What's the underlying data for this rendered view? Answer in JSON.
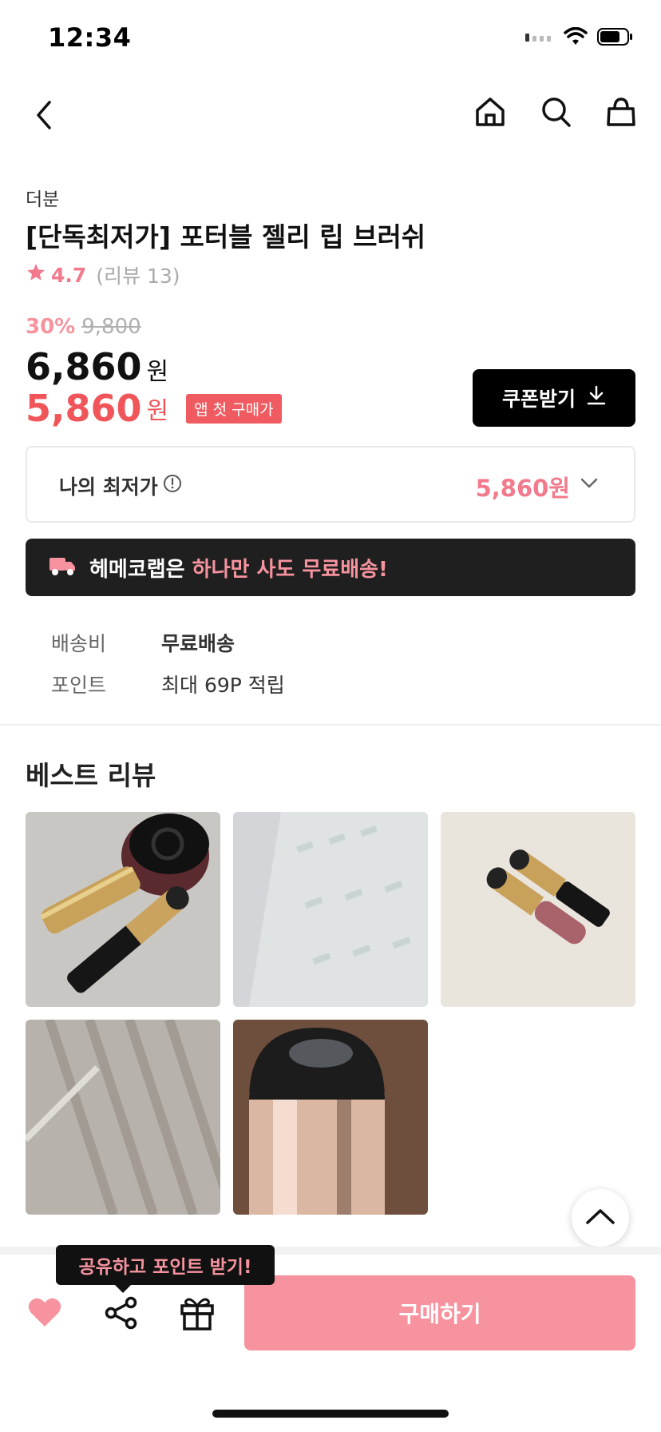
{
  "status_bar": {
    "time": "12:34"
  },
  "nav": {
    "back_icon": "chevron-left-icon",
    "home_icon": "home-icon",
    "search_icon": "search-icon",
    "cart_icon": "shopping-bag-icon"
  },
  "product": {
    "brand": "더분",
    "title": "[단독최저가] 포터블 젤리 립 브러쉬",
    "rating": "4.7",
    "review_count": "(리뷰 13)",
    "discount_percent": "30%",
    "original_price": "9,800",
    "price": "6,860",
    "price_unit": "원",
    "sale_price": "5,860",
    "sale_unit": "원",
    "app_badge": "앱 첫 구매가"
  },
  "coupon_button": {
    "label": "쿠폰받기"
  },
  "lowest_price": {
    "label": "나의 최저가",
    "value": "5,860원"
  },
  "shipping_banner": {
    "prefix": "헤메코랩은 ",
    "highlight": "하나만 사도 무료배송!"
  },
  "info": [
    {
      "label": "배송비",
      "value": "무료배송"
    },
    {
      "label": "포인트",
      "value": "최대 69P 적립"
    }
  ],
  "best_reviews": {
    "title": "베스트 리뷰",
    "photos": [
      "review-photo-1",
      "review-photo-2",
      "review-photo-3",
      "review-photo-4",
      "review-photo-5"
    ]
  },
  "bottom_bar": {
    "share_tooltip": "공유하고 포인트 받기!",
    "buy_label": "구매하기"
  },
  "colors": {
    "accent_pink": "#f6939f",
    "sale_red": "#f0555a",
    "rating_pink": "#f27a8c",
    "dark": "#1f1f1f"
  }
}
